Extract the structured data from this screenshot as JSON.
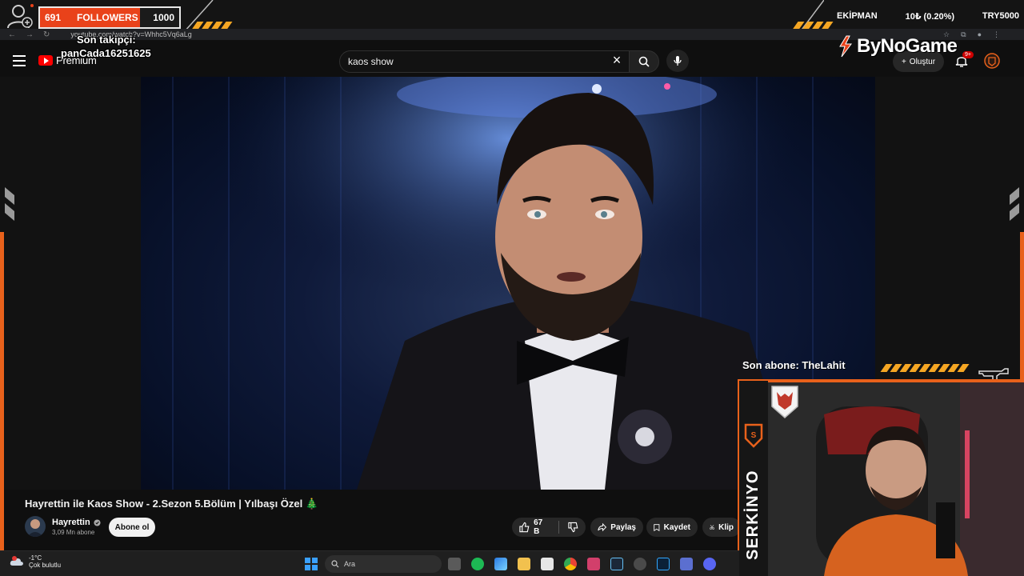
{
  "overlay": {
    "followers_current": "691",
    "followers_label": "FOLLOWERS",
    "followers_goal": "1000",
    "last_follower_label": "Son takipçi:",
    "last_follower_name": "panCada16251625",
    "brand": "ByNoGame",
    "ticker_left": "EKİPMAN",
    "ticker_mid": "10₺ (0.20%)",
    "ticker_right": "TRY5000",
    "last_sub_label": "Son abone: TheLahit",
    "streamer_name": "SERKİNYO"
  },
  "browser": {
    "url": "youtube.com/watch?v=Whhc5Vq6aLg"
  },
  "header": {
    "logo_text": "Premium",
    "search_value": "kaos show",
    "create_label": "Oluştur",
    "notification_badge": "9+"
  },
  "video": {
    "title": "Hayrettin ile Kaos Show - 2.Sezon 5.Bölüm | Yılbaşı Özel 🎄",
    "channel_name": "Hayrettin",
    "subscribers": "3,09 Mn abone",
    "subscribe_label": "Abone ol",
    "likes": "67 B",
    "share_label": "Paylaş",
    "save_label": "Kaydet",
    "clip_label": "Klip"
  },
  "taskbar": {
    "temperature": "-1°C",
    "weather_desc": "Çok bulutlu",
    "search_placeholder": "Ara",
    "weather_badge": "8"
  },
  "colors": {
    "accent_orange": "#e8611b",
    "follower_bar": "#e9421a",
    "stripe_yellow": "#f5a623",
    "yt_red": "#ff0000"
  }
}
